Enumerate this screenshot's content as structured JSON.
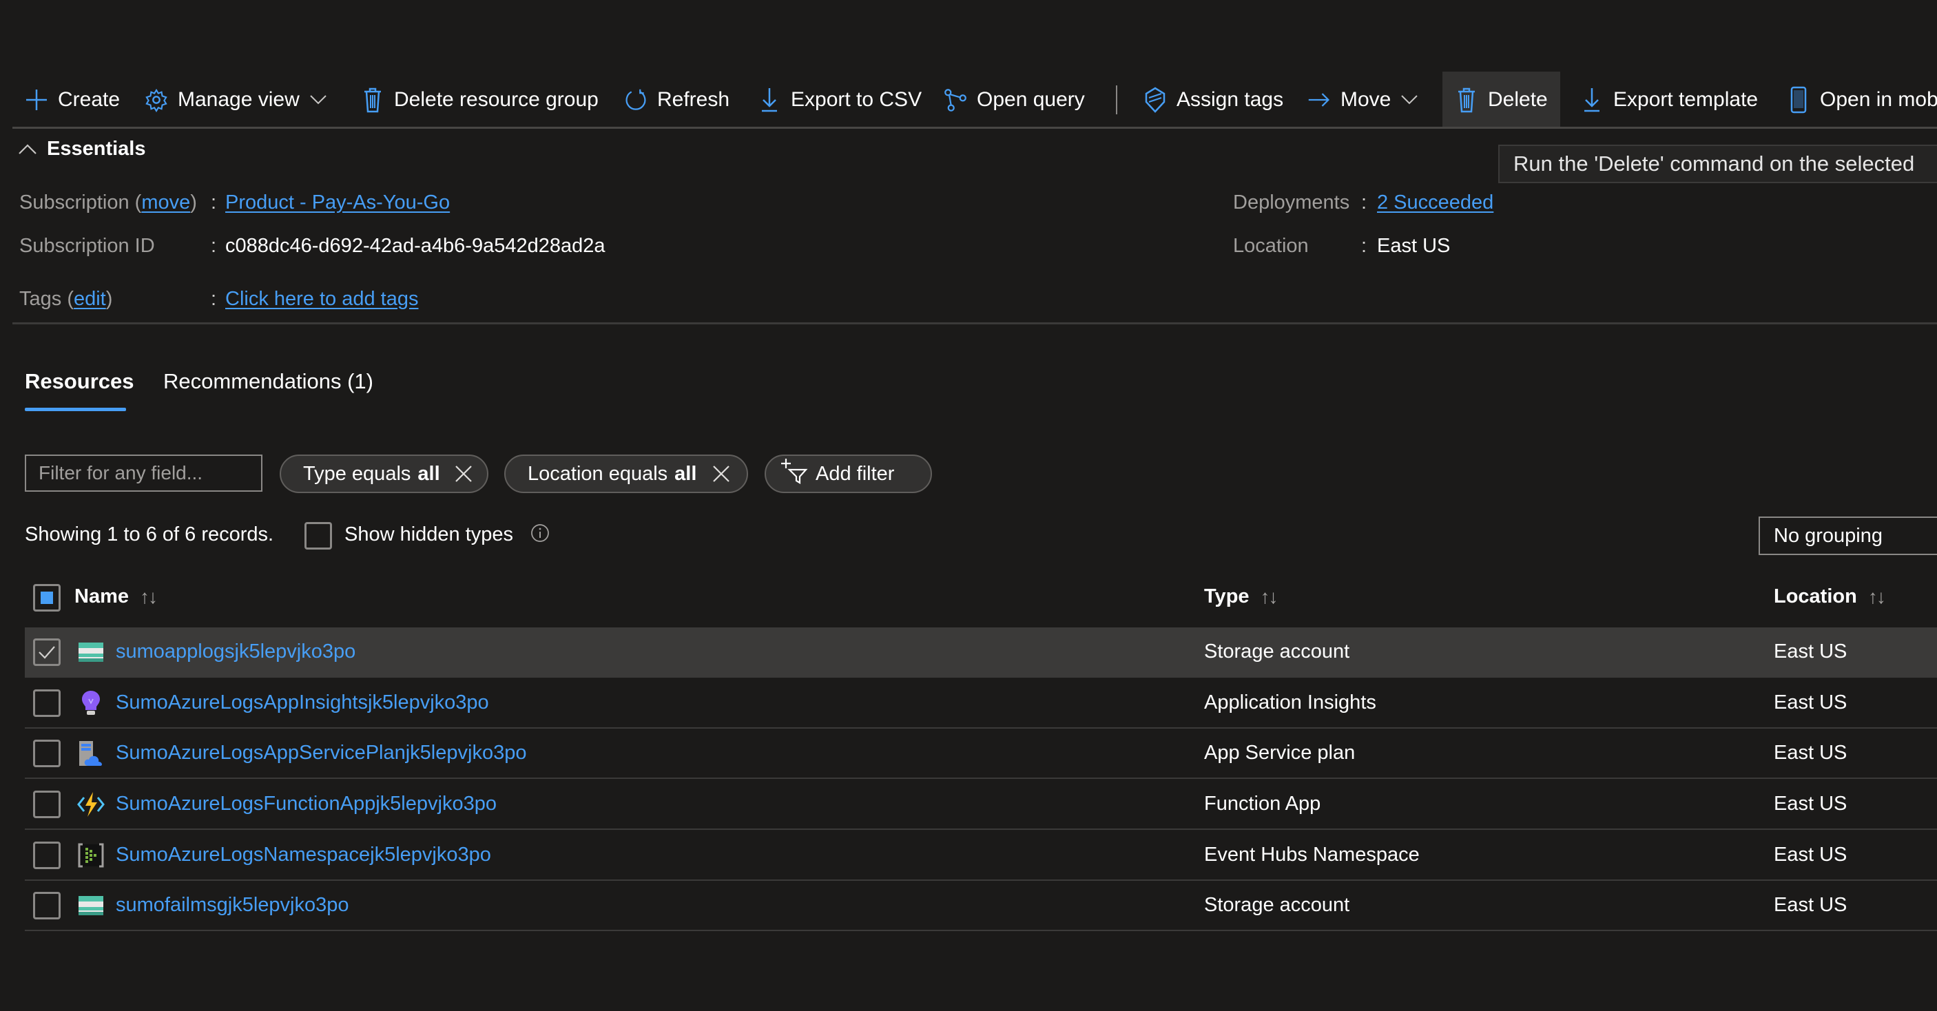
{
  "toolbar": {
    "items": [
      {
        "label": "Create",
        "icon": "plus-icon"
      },
      {
        "label": "Manage view",
        "icon": "gear-icon",
        "dropdown": true
      },
      {
        "label": "Delete resource group",
        "icon": "trash-icon"
      },
      {
        "label": "Refresh",
        "icon": "refresh-icon"
      },
      {
        "label": "Export to CSV",
        "icon": "download-icon"
      },
      {
        "label": "Open query",
        "icon": "query-icon"
      },
      {
        "label": "Assign tags",
        "icon": "tag-icon"
      },
      {
        "label": "Move",
        "icon": "arrow-right-icon",
        "dropdown": true
      },
      {
        "label": "Delete",
        "icon": "trash-icon",
        "hovered": true
      },
      {
        "label": "Export template",
        "icon": "download-icon"
      },
      {
        "label": "Open in mob",
        "icon": "mobile-icon"
      }
    ]
  },
  "tooltip": {
    "text": "Run the 'Delete' command on the selected"
  },
  "essentials": {
    "title": "Essentials",
    "subscription_label": "Subscription",
    "subscription_move_link": "move",
    "subscription_value": "Product - Pay-As-You-Go",
    "subscription_id_label": "Subscription ID",
    "subscription_id_value": "c088dc46-d692-42ad-a4b6-9a542d28ad2a",
    "tags_label": "Tags",
    "tags_edit_link": "edit",
    "tags_value": "Click here to add tags",
    "deployments_label": "Deployments",
    "deployments_value": "2 Succeeded",
    "location_label": "Location",
    "location_value": "East US",
    "colon": ":"
  },
  "tabs": [
    {
      "label": "Resources",
      "active": true
    },
    {
      "label": "Recommendations (1)",
      "active": false
    }
  ],
  "filters": {
    "search_placeholder": "Filter for any field...",
    "pills": [
      {
        "prefix": "Type equals",
        "value": "all"
      },
      {
        "prefix": "Location equals",
        "value": "all"
      }
    ],
    "add_filter_label": "Add filter"
  },
  "records": {
    "showing_text": "Showing 1 to 6 of 6 records.",
    "show_hidden_label": "Show hidden types",
    "show_hidden_checked": false,
    "grouping_value": "No grouping"
  },
  "table": {
    "columns": [
      {
        "label": "Name",
        "sort": "↑↓"
      },
      {
        "label": "Type",
        "sort": "↑↓"
      },
      {
        "label": "Location",
        "sort": "↑↓"
      }
    ],
    "select_all_state": "indeterminate",
    "rows": [
      {
        "name": "sumoapplogsjk5lepvjko3po",
        "type": "Storage account",
        "location": "East US",
        "icon": "storage-account-icon",
        "checked": true
      },
      {
        "name": "SumoAzureLogsAppInsightsjk5lepvjko3po",
        "type": "Application Insights",
        "location": "East US",
        "icon": "application-insights-icon",
        "checked": false
      },
      {
        "name": "SumoAzureLogsAppServicePlanjk5lepvjko3po",
        "type": "App Service plan",
        "location": "East US",
        "icon": "app-service-plan-icon",
        "checked": false
      },
      {
        "name": "SumoAzureLogsFunctionAppjk5lepvjko3po",
        "type": "Function App",
        "location": "East US",
        "icon": "function-app-icon",
        "checked": false
      },
      {
        "name": "SumoAzureLogsNamespacejk5lepvjko3po",
        "type": "Event Hubs Namespace",
        "location": "East US",
        "icon": "event-hubs-icon",
        "checked": false
      },
      {
        "name": "sumofailmsgjk5lepvjko3po",
        "type": "Storage account",
        "location": "East US",
        "icon": "storage-account-icon",
        "checked": false
      }
    ]
  },
  "colors": {
    "background": "#1b1a19",
    "accent": "#479ef5",
    "selected_row": "#3b3a39"
  }
}
